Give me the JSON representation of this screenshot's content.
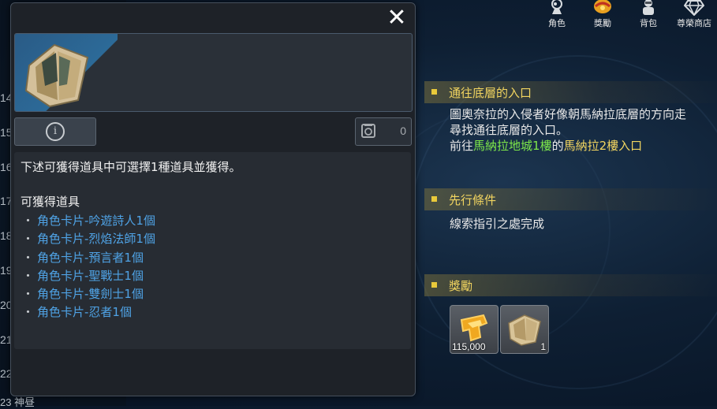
{
  "top_menu": [
    {
      "label": "角色",
      "icon": "character-icon"
    },
    {
      "label": "獎勵",
      "icon": "reward-icon"
    },
    {
      "label": "背包",
      "icon": "bag-icon"
    },
    {
      "label": "尊榮商店",
      "icon": "diamond-icon"
    }
  ],
  "left_list": {
    "numbers": [
      "14",
      "15",
      "16",
      "17",
      "18",
      "19",
      "20",
      "21",
      "22"
    ],
    "bottom_text": "23 神昼"
  },
  "popup": {
    "close_icon": "✕",
    "info_icon": "i",
    "weight_value": "0",
    "description": "下述可獲得道具中可選擇1種道具並獲得。",
    "subheading": "可獲得道具",
    "bullet": "・",
    "items": [
      "角色卡片-吟遊詩人1個",
      "角色卡片-烈焰法師1個",
      "角色卡片-預言者1個",
      "角色卡片-聖戰士1個",
      "角色卡片-雙劍士1個",
      "角色卡片-忍者1個"
    ]
  },
  "quest": {
    "title": "通往底層的入口",
    "desc_line1": "圖奧奈拉的入侵者好像朝馬納拉底層的方向走",
    "desc_line2": "尋找通往底層的入口。",
    "goto_prefix": "前往",
    "goto_place1": "馬納拉地城1樓",
    "goto_mid": "的",
    "goto_place2": "馬納拉2樓入口",
    "prereq_title": "先行條件",
    "prereq_text": "線索指引之處完成",
    "reward_title": "獎勵",
    "rewards": [
      {
        "icon": "gold-coin-icon",
        "count": "115,000"
      },
      {
        "icon": "card-book-icon",
        "count": "1"
      }
    ]
  },
  "colors": {
    "accent_gold": "#f2d560",
    "link_blue": "#4fa3e6",
    "highlight_green": "#7ee84a"
  }
}
